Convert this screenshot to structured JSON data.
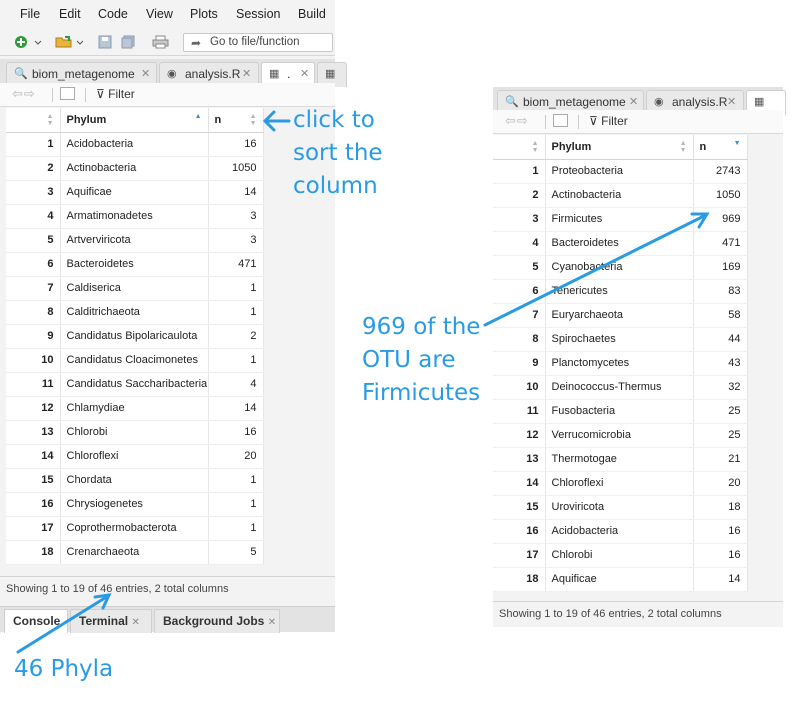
{
  "menu": [
    "File",
    "Edit",
    "Code",
    "View",
    "Plots",
    "Session",
    "Build"
  ],
  "toolbar": {
    "goto_label": "Go to file/function"
  },
  "left_tabs": [
    {
      "label": "biom_metagenome",
      "icon": "search-icon"
    },
    {
      "label": "analysis.R",
      "icon": "r-file-icon"
    },
    {
      "label": ".",
      "icon": "table-icon"
    }
  ],
  "right_tabs": [
    {
      "label": "biom_metagenome",
      "icon": "search-icon"
    },
    {
      "label": "analysis.R",
      "icon": "r-file-icon"
    }
  ],
  "viewer": {
    "filter_label": "Filter"
  },
  "columns": {
    "phylum": "Phylum",
    "n": "n"
  },
  "left_table": {
    "rows": [
      [
        "1",
        "Acidobacteria",
        "16"
      ],
      [
        "2",
        "Actinobacteria",
        "1050"
      ],
      [
        "3",
        "Aquificae",
        "14"
      ],
      [
        "4",
        "Armatimonadetes",
        "3"
      ],
      [
        "5",
        "Artverviricota",
        "3"
      ],
      [
        "6",
        "Bacteroidetes",
        "471"
      ],
      [
        "7",
        "Caldiserica",
        "1"
      ],
      [
        "8",
        "Calditrichaeota",
        "1"
      ],
      [
        "9",
        "Candidatus Bipolaricaulota",
        "2"
      ],
      [
        "10",
        "Candidatus Cloacimonetes",
        "1"
      ],
      [
        "11",
        "Candidatus Saccharibacteria",
        "4"
      ],
      [
        "12",
        "Chlamydiae",
        "14"
      ],
      [
        "13",
        "Chlorobi",
        "16"
      ],
      [
        "14",
        "Chloroflexi",
        "20"
      ],
      [
        "15",
        "Chordata",
        "1"
      ],
      [
        "16",
        "Chrysiogenetes",
        "1"
      ],
      [
        "17",
        "Coprothermobacterota",
        "1"
      ],
      [
        "18",
        "Crenarchaeota",
        "5"
      ]
    ]
  },
  "right_table": {
    "rows": [
      [
        "1",
        "Proteobacteria",
        "2743"
      ],
      [
        "2",
        "Actinobacteria",
        "1050"
      ],
      [
        "3",
        "Firmicutes",
        "969"
      ],
      [
        "4",
        "Bacteroidetes",
        "471"
      ],
      [
        "5",
        "Cyanobacteria",
        "169"
      ],
      [
        "6",
        "Tenericutes",
        "83"
      ],
      [
        "7",
        "Euryarchaeota",
        "58"
      ],
      [
        "8",
        "Spirochaetes",
        "44"
      ],
      [
        "9",
        "Planctomycetes",
        "43"
      ],
      [
        "10",
        "Deinococcus-Thermus",
        "32"
      ],
      [
        "11",
        "Fusobacteria",
        "25"
      ],
      [
        "12",
        "Verrucomicrobia",
        "25"
      ],
      [
        "13",
        "Thermotogae",
        "21"
      ],
      [
        "14",
        "Chloroflexi",
        "20"
      ],
      [
        "15",
        "Uroviricota",
        "18"
      ],
      [
        "16",
        "Acidobacteria",
        "16"
      ],
      [
        "17",
        "Chlorobi",
        "16"
      ],
      [
        "18",
        "Aquificae",
        "14"
      ]
    ]
  },
  "status_text": "Showing 1 to 19 of 46 entries, 2 total columns",
  "bottom_tabs": [
    "Console",
    "Terminal",
    "Background Jobs"
  ],
  "annotations": {
    "sort_note": [
      "click to",
      "sort the",
      "column"
    ],
    "phyla_note": "46 Phyla",
    "firmicutes_note": [
      "969 of the",
      "OTU are",
      "Firmicutes"
    ]
  },
  "colors": {
    "annotation": "#2a9be3",
    "sort_active": "#3a8fd8"
  }
}
